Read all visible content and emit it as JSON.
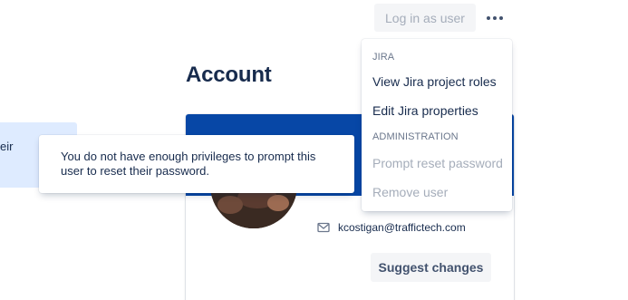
{
  "header": {
    "login_as_user": "Log in as user",
    "more_icon": "more-horizontal-icon"
  },
  "left_panel": {
    "text": "eir"
  },
  "page": {
    "title": "Account"
  },
  "profile": {
    "email": "kcostigan@traffictech.com",
    "email_icon": "envelope-icon",
    "suggest_changes": "Suggest changes",
    "header_color": "#0747a6"
  },
  "menu": {
    "sections": [
      {
        "heading": "JIRA",
        "items": [
          {
            "label": "View Jira project roles",
            "disabled": false
          },
          {
            "label": "Edit Jira properties",
            "disabled": false
          }
        ]
      },
      {
        "heading": "ADMINISTRATION",
        "items": [
          {
            "label": "Prompt reset password",
            "disabled": true
          },
          {
            "label": "Remove user",
            "disabled": true
          }
        ]
      }
    ]
  },
  "tooltip": {
    "text": "You do not have enough privileges to prompt this user to reset their password."
  }
}
